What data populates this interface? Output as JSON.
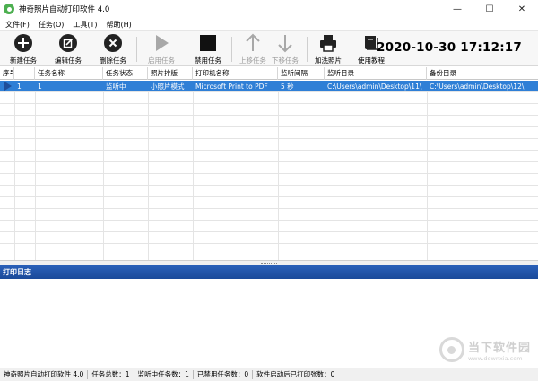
{
  "window": {
    "title": "神奇照片自动打印软件 4.0",
    "controls": {
      "minimize": "—",
      "maximize": "☐",
      "close": "✕"
    }
  },
  "menu": [
    {
      "label": "文件(F)"
    },
    {
      "label": "任务(O)"
    },
    {
      "label": "工具(T)"
    },
    {
      "label": "帮助(H)"
    }
  ],
  "toolbar": {
    "new_task": "新建任务",
    "edit_task": "编辑任务",
    "delete_task": "删除任务",
    "enable_task": "启用任务",
    "disable_task": "禁用任务",
    "move_up": "上移任务",
    "move_down": "下移任务",
    "add_print": "加洗照片",
    "tutorial": "使用教程"
  },
  "clock": "2020-10-30 17:12:17",
  "grid": {
    "columns": [
      "序号",
      "任务名称",
      "任务状态",
      "照片排版",
      "打印机名称",
      "监听间隔",
      "监听目录",
      "备份目录"
    ],
    "rows": [
      {
        "index": "1",
        "name": "1",
        "status": "监听中",
        "layout": "小照片模式",
        "printer": "Microsoft Print to PDF",
        "interval": "5 秒",
        "watch_dir": "C:\\Users\\admin\\Desktop\\11\\",
        "backup_dir": "C:\\Users\\admin\\Desktop\\12\\"
      }
    ]
  },
  "log": {
    "title": "打印日志"
  },
  "watermark": {
    "cn": "当下软件园",
    "url": "www.downxia.com"
  },
  "status": {
    "app": "神奇照片自动打印软件 4.0",
    "total": "任务总数：1",
    "listening": "监听中任务数：1",
    "disabled": "已禁用任务数：0",
    "printed": "软件启动后已打印张数：0"
  }
}
